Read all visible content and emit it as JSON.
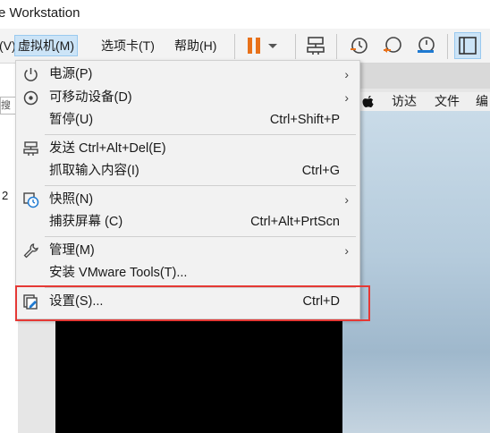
{
  "window": {
    "title": "e Workstation"
  },
  "menubar": {
    "items": [
      {
        "label": "(V)"
      },
      {
        "label": "虚拟机(M)"
      },
      {
        "label": "选项卡(T)"
      },
      {
        "label": "帮助(H)"
      }
    ]
  },
  "left_panel": {
    "search_placeholder": "搜索",
    "number": "2"
  },
  "guest_menubar": {
    "items": [
      "访达",
      "文件",
      "编"
    ]
  },
  "vm_menu": {
    "items": [
      {
        "label": "电源(P)",
        "shortcut": "",
        "submenu": true,
        "icon": "power-icon"
      },
      {
        "label": "可移动设备(D)",
        "shortcut": "",
        "submenu": true,
        "icon": "removable-device-icon"
      },
      {
        "label": "暂停(U)",
        "shortcut": "Ctrl+Shift+P",
        "submenu": false,
        "icon": ""
      },
      {
        "label": "发送 Ctrl+Alt+Del(E)",
        "shortcut": "",
        "submenu": false,
        "icon": "send-keys-icon"
      },
      {
        "label": "抓取输入内容(I)",
        "shortcut": "Ctrl+G",
        "submenu": false,
        "icon": ""
      },
      {
        "label": "快照(N)",
        "shortcut": "",
        "submenu": true,
        "icon": "snapshot-icon"
      },
      {
        "label": "捕获屏幕 (C)",
        "shortcut": "Ctrl+Alt+PrtScn",
        "submenu": false,
        "icon": ""
      },
      {
        "label": "管理(M)",
        "shortcut": "",
        "submenu": true,
        "icon": "wrench-icon"
      },
      {
        "label": "安装 VMware Tools(T)...",
        "shortcut": "",
        "submenu": false,
        "icon": ""
      },
      {
        "label": "设置(S)...",
        "shortcut": "Ctrl+D",
        "submenu": false,
        "icon": "settings-icon"
      }
    ]
  },
  "colors": {
    "menu_bg": "#f2f2f2",
    "active_menu": "#cce4f7",
    "highlight_border": "#e53935",
    "pause_orange": "#e8711a",
    "snapshot_blue": "#1f7ad1"
  }
}
